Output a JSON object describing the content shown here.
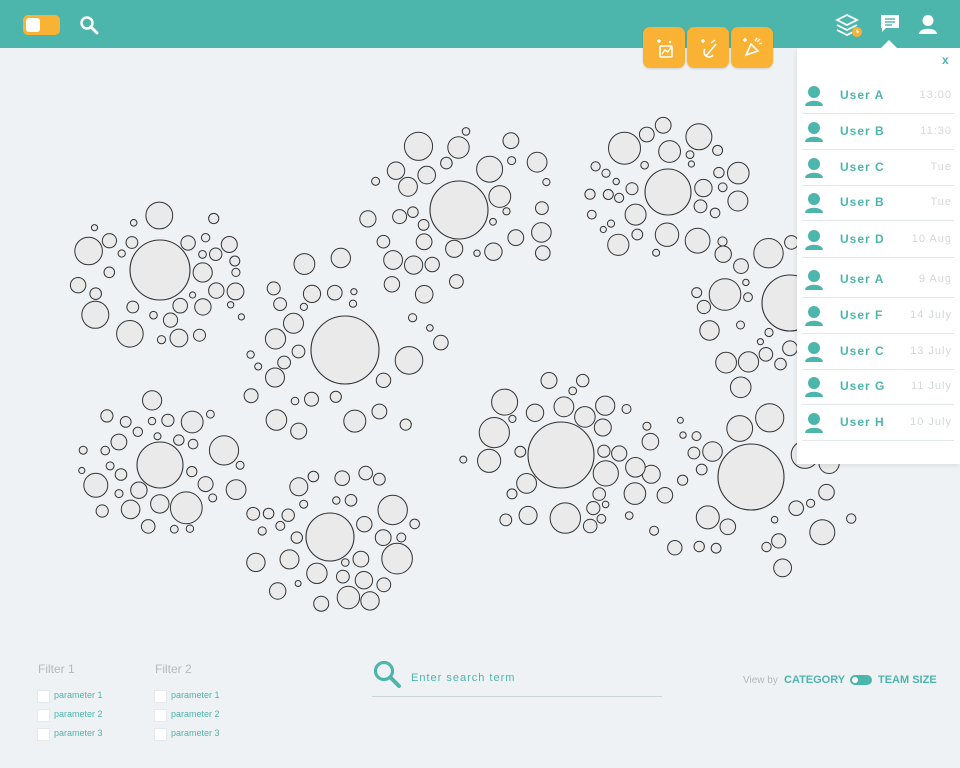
{
  "colors": {
    "accent": "#4db6ac",
    "tool": "#f9b233",
    "bubble_fill": "#eaeaea",
    "bubble_stroke": "#333333",
    "background": "#eff2f4"
  },
  "header": {
    "mode_toggle": "on",
    "icons": [
      "search-icon",
      "layers-icon",
      "chat-icon",
      "user-icon"
    ]
  },
  "tools": [
    "add-chart-tool-icon",
    "remove-tool-icon",
    "celebrate-tool-icon"
  ],
  "messages": {
    "close_label": "x",
    "items": [
      {
        "name": "User A",
        "time": "13:00"
      },
      {
        "name": "User B",
        "time": "11:30"
      },
      {
        "name": "User C",
        "time": "Tue"
      },
      {
        "name": "User B",
        "time": "Tue"
      },
      {
        "name": "User D",
        "time": "10 Aug"
      },
      {
        "name": "User A",
        "time": "9 Aug"
      },
      {
        "name": "User F",
        "time": "14 July"
      },
      {
        "name": "User C",
        "time": "13 July"
      },
      {
        "name": "User G",
        "time": "11 July"
      },
      {
        "name": "User H",
        "time": "10 July"
      }
    ]
  },
  "filters": [
    {
      "title": "Filter 1",
      "params": [
        "parameter 1",
        "parameter 2",
        "parameter 3"
      ]
    },
    {
      "title": "Filter 2",
      "params": [
        "parameter 1",
        "parameter 2",
        "parameter 3"
      ]
    }
  ],
  "search": {
    "placeholder": "Enter search term"
  },
  "view": {
    "label": "View by",
    "option_left": "CATEGORY",
    "option_right": "TEAM SIZE"
  }
}
